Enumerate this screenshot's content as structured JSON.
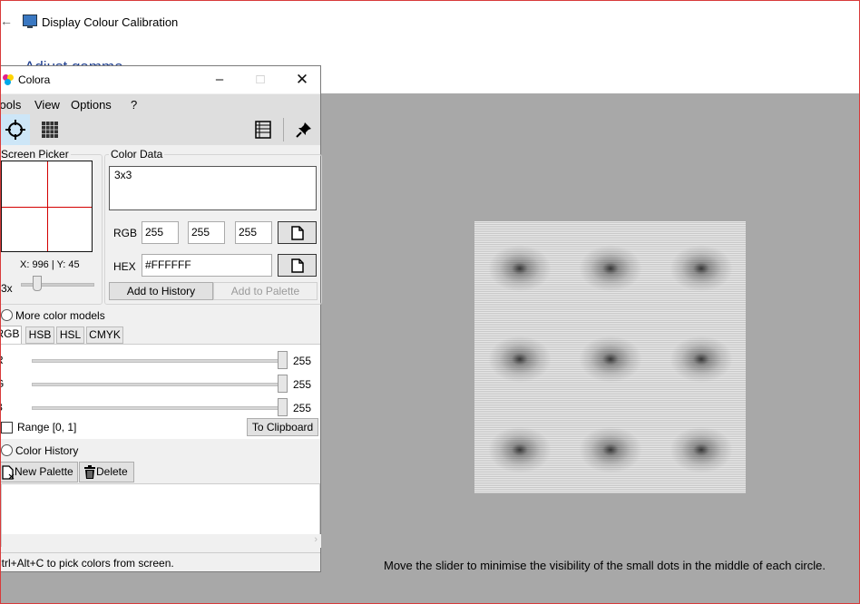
{
  "calibration": {
    "window_title": "Display Colour Calibration",
    "heading": "Adjust gamma",
    "instruction": "Move the slider to minimise the visibility of the small dots in the middle of each circle."
  },
  "colora": {
    "title": "Colora",
    "menu": [
      "Tools",
      "View",
      "Options",
      "?"
    ],
    "screen_picker": {
      "label": "Screen Picker",
      "coords": "X: 996 | Y: 45",
      "zoom": "3x"
    },
    "color_data": {
      "label": "Color Data",
      "name": "3x3",
      "rgb_label": "RGB",
      "r": "255",
      "g": "255",
      "b": "255",
      "hex_label": "HEX",
      "hex": "#FFFFFF",
      "add_history": "Add to History",
      "add_palette": "Add to Palette"
    },
    "more_models": {
      "label": "More color models",
      "tabs": [
        "RGB",
        "HSB",
        "HSL",
        "CMYK"
      ],
      "sliders": [
        {
          "label": "R",
          "value": "255"
        },
        {
          "label": "G",
          "value": "255"
        },
        {
          "label": "B",
          "value": "255"
        }
      ],
      "range_label": "Range [0, 1]",
      "clipboard_button": "To Clipboard"
    },
    "history": {
      "label": "Color History",
      "new_palette": "New Palette",
      "delete": "Delete"
    },
    "status": "Ctrl+Alt+C to pick colors from screen."
  },
  "colors": {
    "crosshair": "#d40000",
    "calibration_bg": "#a8a8a8",
    "heading": "#1f3f8f"
  }
}
